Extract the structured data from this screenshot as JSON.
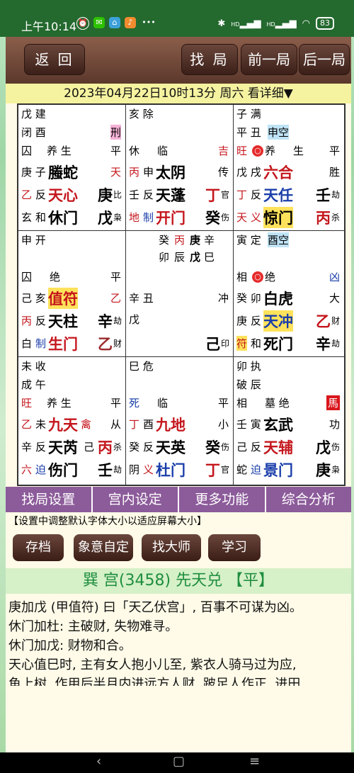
{
  "status": {
    "time": "上午10:14",
    "battery": "83",
    "hd1": "HD",
    "hd2": "HD"
  },
  "toolbar": {
    "back": "返 回",
    "find": "找 局",
    "prev": "前一局",
    "next": "后一局"
  },
  "date": "2023年04月22日10时13分 周六 看详细▼",
  "palaces": {
    "p1": {
      "r1": "戊 建",
      "r2a": "闭 酉",
      "r2b": "刑",
      "r3a": "囚",
      "r3b": "养 生",
      "r3c": "平",
      "r4a": "庚 子",
      "r4b": "螣蛇",
      "r4c": "天",
      "r5a": "乙",
      "r5b": "反",
      "r5c": "天心",
      "r5d": "庚",
      "r5e": "比",
      "r6a": "玄",
      "r6b": "和",
      "r6c": "休门",
      "r6d": "戊",
      "r6e": "枭"
    },
    "p2": {
      "r1": "亥 除",
      "r3a": "休",
      "r3b": "临",
      "r3c": "吉",
      "r4a": "丙",
      "r4b": "申",
      "r4c": "太阴",
      "r4d": "传",
      "r5a": "壬",
      "r5b": "反",
      "r5c": "天蓬",
      "r5d": "丁",
      "r5e": "官",
      "r6a": "地",
      "r6b": "制",
      "r6c": "开门",
      "r6d": "癸",
      "r6e": "伤"
    },
    "p3": {
      "r1": "子 满",
      "r2a": "平 丑",
      "r2b": "申空",
      "r3a": "旺",
      "r3b": "养",
      "r3c": "生",
      "r3d": "平",
      "r4a": "戊 戌",
      "r4b": "六合",
      "r4c": "胜",
      "r5a": "丁",
      "r5b": "反",
      "r5c": "天任",
      "r5d": "壬",
      "r5e": "劫",
      "r6a": "天",
      "r6b": "义",
      "r6c": "惊门",
      "r6d": "丙",
      "r6e": "杀"
    },
    "p4": {
      "r1": "申 开",
      "r3a": "囚",
      "r3b": "绝",
      "r3c": "平",
      "r4a": "己 亥",
      "r4b": "值符",
      "r4c": "乙",
      "r5a": "丙",
      "r5b": "反",
      "r5c": "天柱",
      "r5d": "辛",
      "r5e": "劫",
      "r6a": "白",
      "r6b": "制",
      "r6c": "生门",
      "r6d": "乙",
      "r6e": "财"
    },
    "p5": {
      "r1a": "癸",
      "r1b": "丙",
      "r1c": "庚",
      "r1d": "辛",
      "r2a": "卯",
      "r2b": "辰",
      "r2c": "戊",
      "r2d": "巳",
      "r4a": "辛 丑",
      "r4b": "冲",
      "r5a": "戊",
      "r6a": "己",
      "r6b": "印"
    },
    "p6": {
      "r1": "寅 定",
      "r1b": "酉空",
      "r3a": "相",
      "r3b": "绝",
      "r3c": "凶",
      "r4a": "癸 卯",
      "r4b": "白虎",
      "r4c": "大",
      "r5a": "庚",
      "r5b": "反",
      "r5c": "天冲",
      "r5d": "乙",
      "r5e": "财",
      "r6a": "符",
      "r6b": "和",
      "r6c": "死门",
      "r6d": "辛",
      "r6e": "劫"
    },
    "p7": {
      "r1": "未 收",
      "r2": "成 午",
      "r3a": "旺",
      "r3b": "养 生",
      "r3c": "平",
      "r4a": "乙",
      "r4b": "未",
      "r4c": "九天",
      "r4d": "禽",
      "r4e": "从",
      "r5a": "辛",
      "r5b": "反",
      "r5c": "天芮",
      "r5d": "己",
      "r5e": "丙",
      "r5f": "杀",
      "r6a": "六",
      "r6b": "迫",
      "r6c": "伤门",
      "r6d": "壬",
      "r6e": "劫"
    },
    "p8": {
      "r1": "巳 危",
      "r3a": "死",
      "r3b": "临",
      "r3c": "平",
      "r4a": "丁",
      "r4b": "酉",
      "r4c": "九地",
      "r4d": "小",
      "r5a": "癸",
      "r5b": "反",
      "r5c": "天英",
      "r5d": "癸",
      "r5e": "伤",
      "r6a": "阴",
      "r6b": "义",
      "r6c": "杜门",
      "r6d": "丁",
      "r6e": "官"
    },
    "p9": {
      "r1": "卯 执",
      "r2": "破 辰",
      "r3a": "相",
      "r3b": "墓 绝",
      "r3c": "馬",
      "r4a": "壬 寅",
      "r4b": "玄武",
      "r4c": "功",
      "r5a": "己",
      "r5b": "反",
      "r5c": "天辅",
      "r5d": "戊",
      "r5e": "伤",
      "r6a": "蛇",
      "r6b": "迫",
      "r6c": "景门",
      "r6d": "庚",
      "r6e": "枭"
    }
  },
  "menu": [
    "找局设置",
    "宫内设定",
    "更多功能",
    "综合分析"
  ],
  "hint": "【设置中调整默认字体大小以适应屏幕大小】",
  "buttons": [
    "存档",
    "象意自定",
    "找大师",
    "学习"
  ],
  "palace_title": "巽 宫(3458) 先天兑 【平】",
  "desc": [
    "庚加戊 (甲值符) 曰「天乙伏宫」, 百事不可谋为凶。",
    "休门加杜: 主破财, 失物难寻。",
    "休门加戊: 财物和合。",
    "天心值巳时, 主有女人抱小儿至, 紫衣人骑马过为应,",
    "鱼上树. 作用后半月内进远方人财. 跛足人作正. 进田"
  ]
}
